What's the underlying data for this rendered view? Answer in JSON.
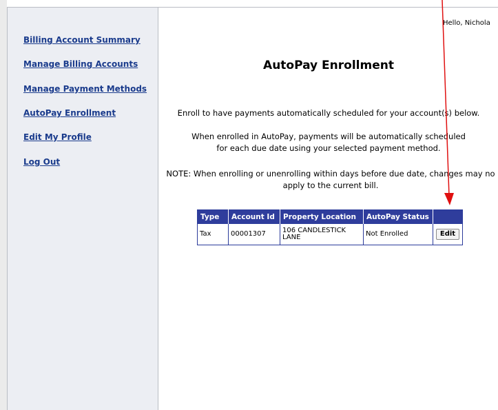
{
  "sidebar": {
    "items": [
      {
        "label": "Billing Account Summary"
      },
      {
        "label": "Manage Billing Accounts"
      },
      {
        "label": "Manage Payment Methods"
      },
      {
        "label": "AutoPay Enrollment"
      },
      {
        "label": "Edit My Profile"
      },
      {
        "label": "Log Out"
      }
    ]
  },
  "header": {
    "greeting": "Hello, Nichola"
  },
  "main": {
    "title": "AutoPay Enrollment",
    "intro": "Enroll to have payments automatically scheduled for your account(s) below.",
    "info_line1": "When enrolled in AutoPay, payments will be automatically scheduled",
    "info_line2": "for each due date using your selected payment method.",
    "note_line1": "NOTE: When enrolling or unenrolling within days before due date, changes may no",
    "note_line2": "apply to the current bill."
  },
  "table": {
    "headers": {
      "type": "Type",
      "account_id": "Account Id",
      "property_location": "Property Location",
      "autopay_status": "AutoPay Status",
      "action": ""
    },
    "rows": [
      {
        "type": "Tax",
        "account_id": "00001307",
        "property_location": "106 CANDLESTICK LANE",
        "autopay_status": "Not Enrolled",
        "action_label": "Edit"
      }
    ]
  },
  "annotation": {
    "arrow_color": "#e01010",
    "arrow_target": "Edit button"
  }
}
